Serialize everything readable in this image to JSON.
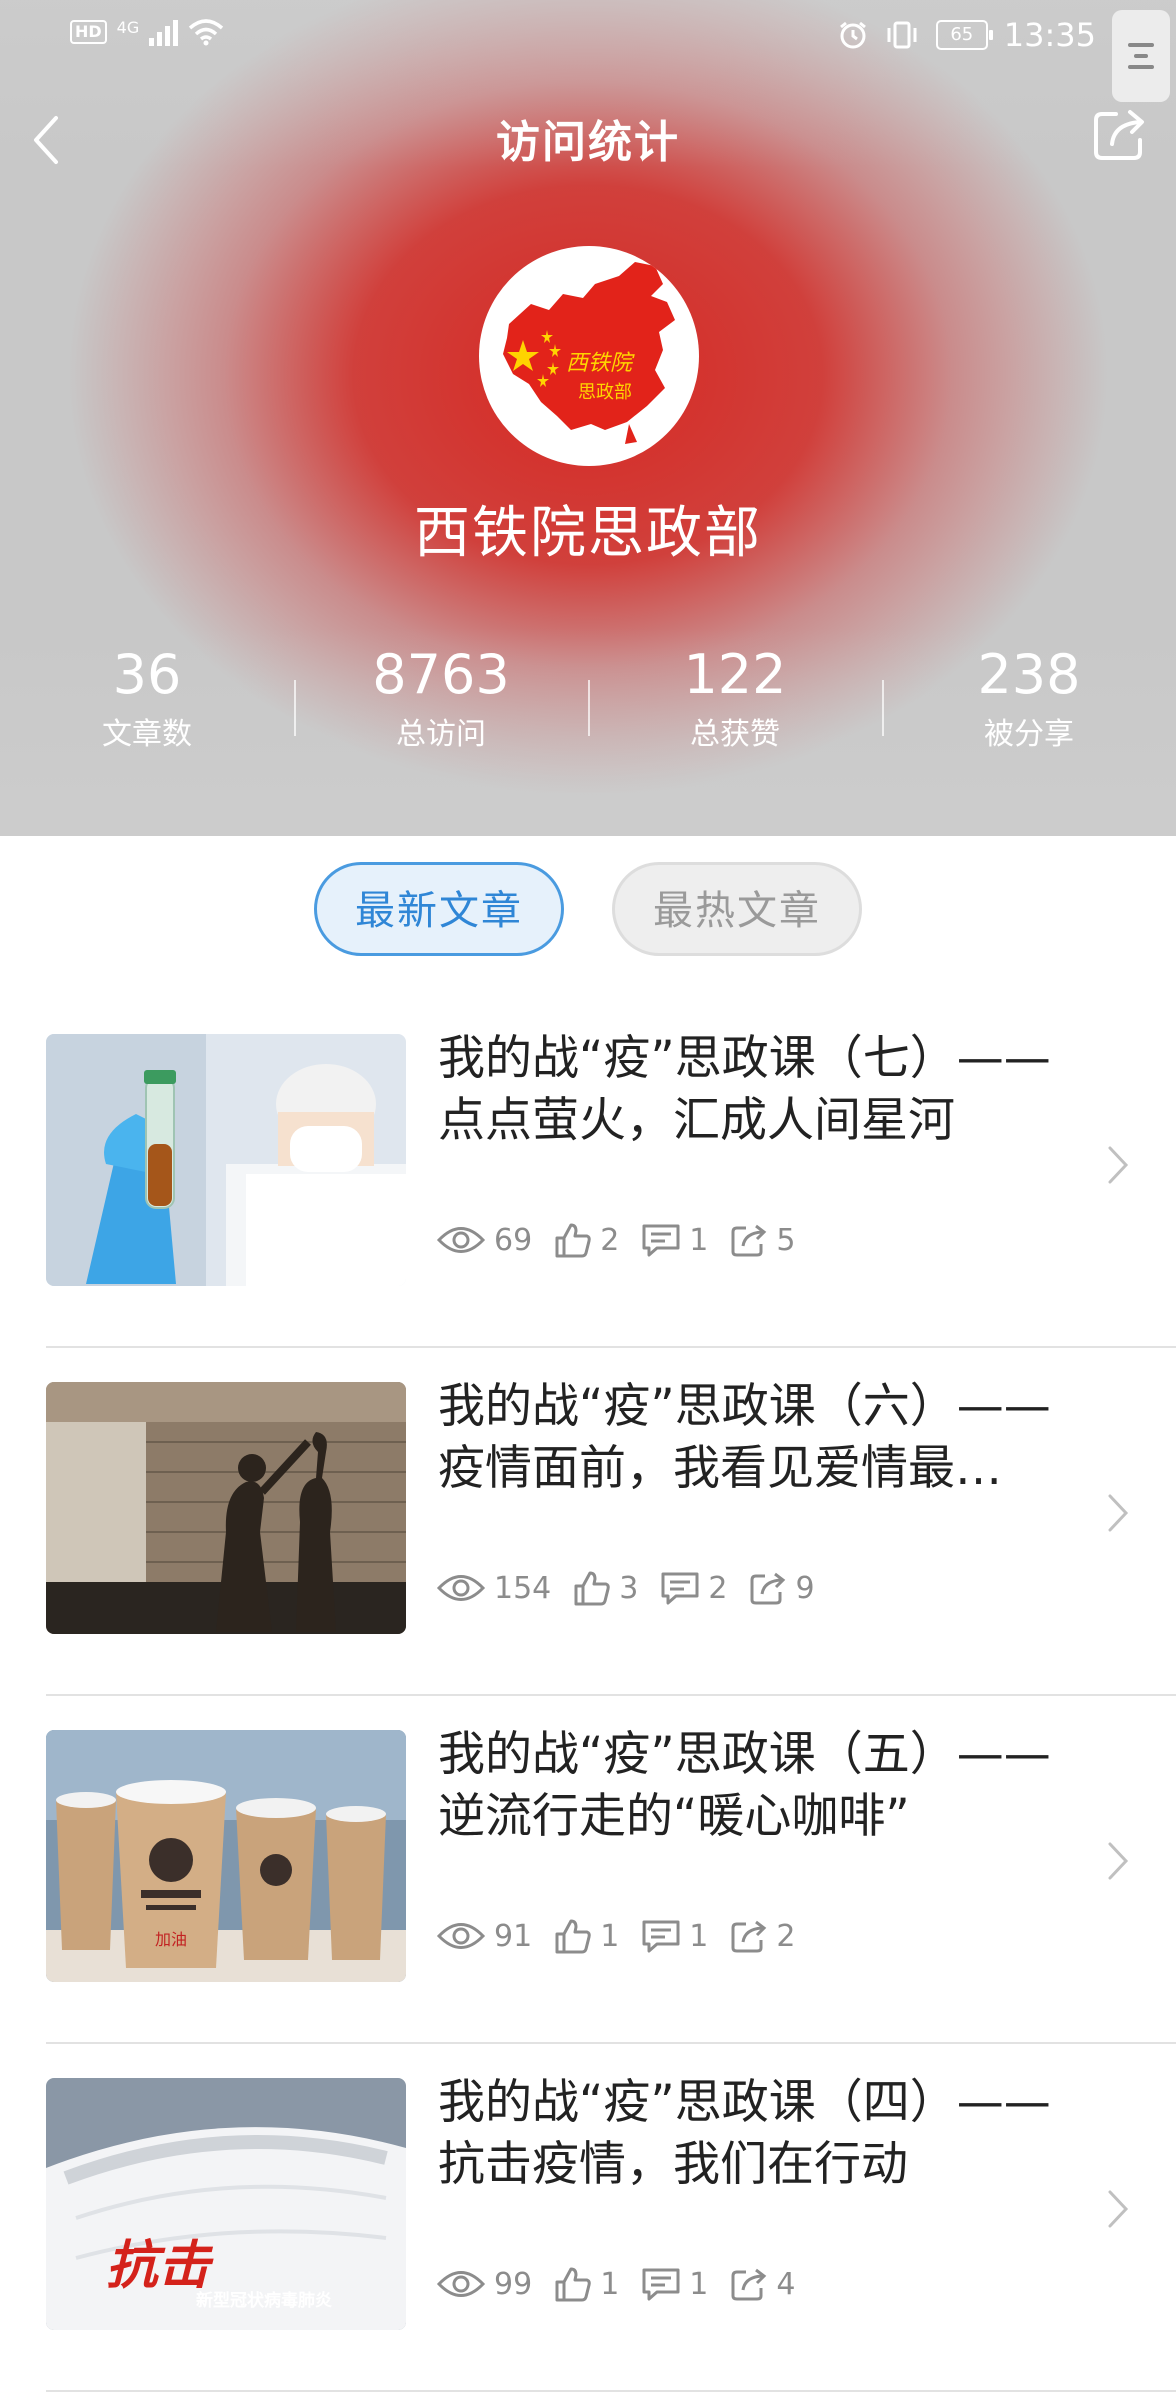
{
  "status_bar": {
    "hd": "HD",
    "network": "4G",
    "battery": "65",
    "time": "13:35"
  },
  "nav": {
    "title": "访问统计"
  },
  "profile": {
    "name": "西铁院思政部",
    "avatar_text_line1": "西铁院",
    "avatar_text_line2": "思政部"
  },
  "stats": [
    {
      "value": "36",
      "label": "文章数"
    },
    {
      "value": "8763",
      "label": "总访问"
    },
    {
      "value": "122",
      "label": "总获赞"
    },
    {
      "value": "238",
      "label": "被分享"
    }
  ],
  "tabs": {
    "latest": "最新文章",
    "hottest": "最热文章",
    "selected": "latest"
  },
  "articles": [
    {
      "title": "我的战“疫”思政课（七）——点点萤火，汇成人间星河",
      "views": "69",
      "likes": "2",
      "comments": "1",
      "shares": "5"
    },
    {
      "title": "我的战“疫”思政课（六）——疫情面前，我看见爱情最…",
      "views": "154",
      "likes": "3",
      "comments": "2",
      "shares": "9"
    },
    {
      "title": "我的战“疫”思政课（五）——逆流行走的“暖心咖啡”",
      "views": "91",
      "likes": "1",
      "comments": "1",
      "shares": "2"
    },
    {
      "title": "我的战“疫”思政课（四）——抗击疫情，我们在行动",
      "views": "99",
      "likes": "1",
      "comments": "1",
      "shares": "4",
      "thumb_text_main": "抗击",
      "thumb_text_sub": "新型冠状病毒肺炎"
    }
  ],
  "colors": {
    "accent": "#2f86d6",
    "header_red": "#d7201a"
  }
}
